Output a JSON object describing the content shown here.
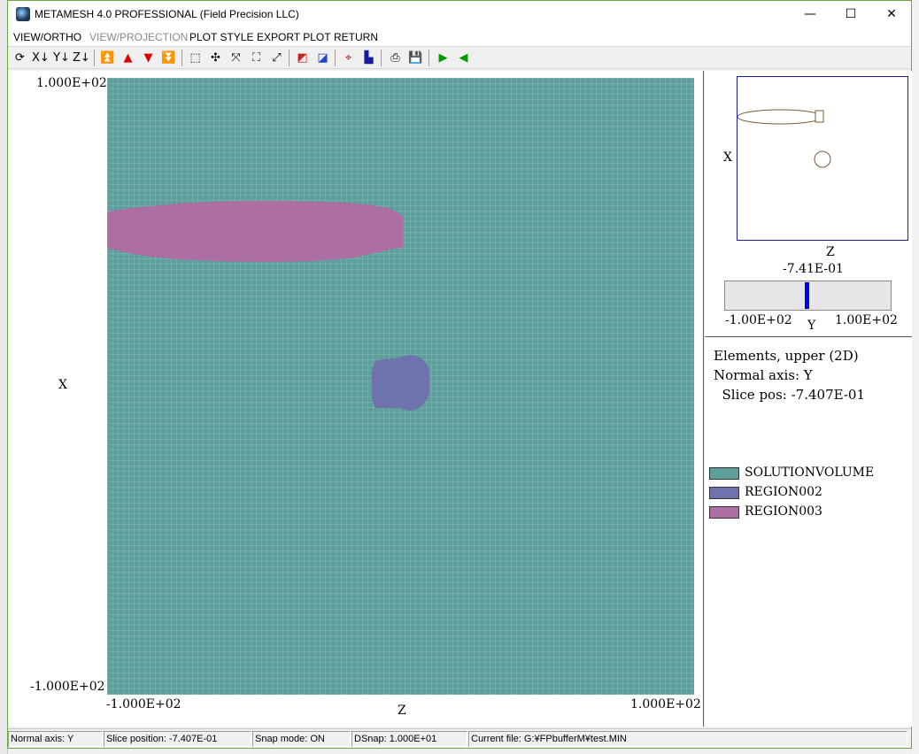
{
  "window": {
    "title": "METAMESH 4.0 PROFESSIONAL (Field Precision LLC)",
    "minimize_glyph": "—",
    "maximize_glyph": "☐",
    "close_glyph": "✕"
  },
  "menu": [
    {
      "label": "VIEW/ORTHO",
      "enabled": true
    },
    {
      "label": "VIEW/PROJECTION",
      "enabled": false
    },
    {
      "label": "PLOT STYLE",
      "enabled": true
    },
    {
      "label": "EXPORT PLOT",
      "enabled": true
    },
    {
      "label": "RETURN",
      "enabled": true
    }
  ],
  "toolbar": {
    "buttons": [
      {
        "icon": "rotate-view-icon",
        "glyph": "⟳",
        "color": "#000000"
      },
      {
        "icon": "x-axis-view-icon",
        "glyph": "X↓",
        "color": "#000000"
      },
      {
        "icon": "y-axis-view-icon",
        "glyph": "Y↓",
        "color": "#000000"
      },
      {
        "icon": "z-axis-view-icon",
        "glyph": "Z↓",
        "color": "#000000"
      },
      {
        "icon": "move-top-icon",
        "glyph": "⏫",
        "color": "#dd0000"
      },
      {
        "icon": "move-up-icon",
        "glyph": "▲",
        "color": "#dd0000"
      },
      {
        "icon": "move-down-icon",
        "glyph": "▼",
        "color": "#dd0000"
      },
      {
        "icon": "move-bottom-icon",
        "glyph": "⏬",
        "color": "#dd0000"
      },
      {
        "icon": "zoom-window-icon",
        "glyph": "⬚",
        "color": "#000000"
      },
      {
        "icon": "zoom-in-icon",
        "glyph": "✣",
        "color": "#000000"
      },
      {
        "icon": "zoom-out-icon",
        "glyph": "⤧",
        "color": "#000000"
      },
      {
        "icon": "zoom-fit-icon",
        "glyph": "⛶",
        "color": "#1a1aa0"
      },
      {
        "icon": "zoom-reset-icon",
        "glyph": "⤢",
        "color": "#000000"
      },
      {
        "icon": "color-palette-icon",
        "glyph": "◩",
        "color": "#cc2222"
      },
      {
        "icon": "region-color-icon",
        "glyph": "◪",
        "color": "#2244cc"
      },
      {
        "icon": "crosshair-icon",
        "glyph": "⌖",
        "color": "#cc0000"
      },
      {
        "icon": "info-icon",
        "glyph": "▙",
        "color": "#1a1aa0"
      },
      {
        "icon": "print-icon",
        "glyph": "⎙",
        "color": "#000000"
      },
      {
        "icon": "save-icon",
        "glyph": "💾",
        "color": "#1a1aa0"
      },
      {
        "icon": "play-forward-icon",
        "glyph": "▶",
        "color": "#009900"
      },
      {
        "icon": "play-back-icon",
        "glyph": "◀",
        "color": "#009900"
      }
    ]
  },
  "plot": {
    "y_max_label": "1.000E+02",
    "y_min_label": "-1.000E+02",
    "x_min_label": "-1.000E+02",
    "x_max_label": "1.000E+02",
    "vertical_axis_label": "X",
    "horizontal_axis_label": "Z",
    "region_colors": {
      "solution": "#5e9e9b",
      "region002": "#6f73ad",
      "region003": "#ad6fa3"
    }
  },
  "sidebar": {
    "mini_x_label": "X",
    "mini_z_label": "Z",
    "slice_value": "-7.41E-01",
    "slider_min": "-1.00E+02",
    "slider_max": "1.00E+02",
    "slider_axis": "Y",
    "slider_fraction": 0.496,
    "info_lines": [
      "Elements, upper (2D)",
      "Normal axis: Y",
      "  Slice pos: -7.407E-01"
    ],
    "legend": [
      {
        "label": "SOLUTIONVOLUME",
        "color": "#5e9e9b"
      },
      {
        "label": "REGION002",
        "color": "#6f73ad"
      },
      {
        "label": "REGION003",
        "color": "#ad6fa3"
      }
    ]
  },
  "status": [
    "Normal axis: Y",
    "Slice position:  -7.407E-01",
    "Snap mode: ON",
    "DSnap:   1.000E+01",
    "Current file: G:¥FPbufferM¥test.MIN"
  ]
}
